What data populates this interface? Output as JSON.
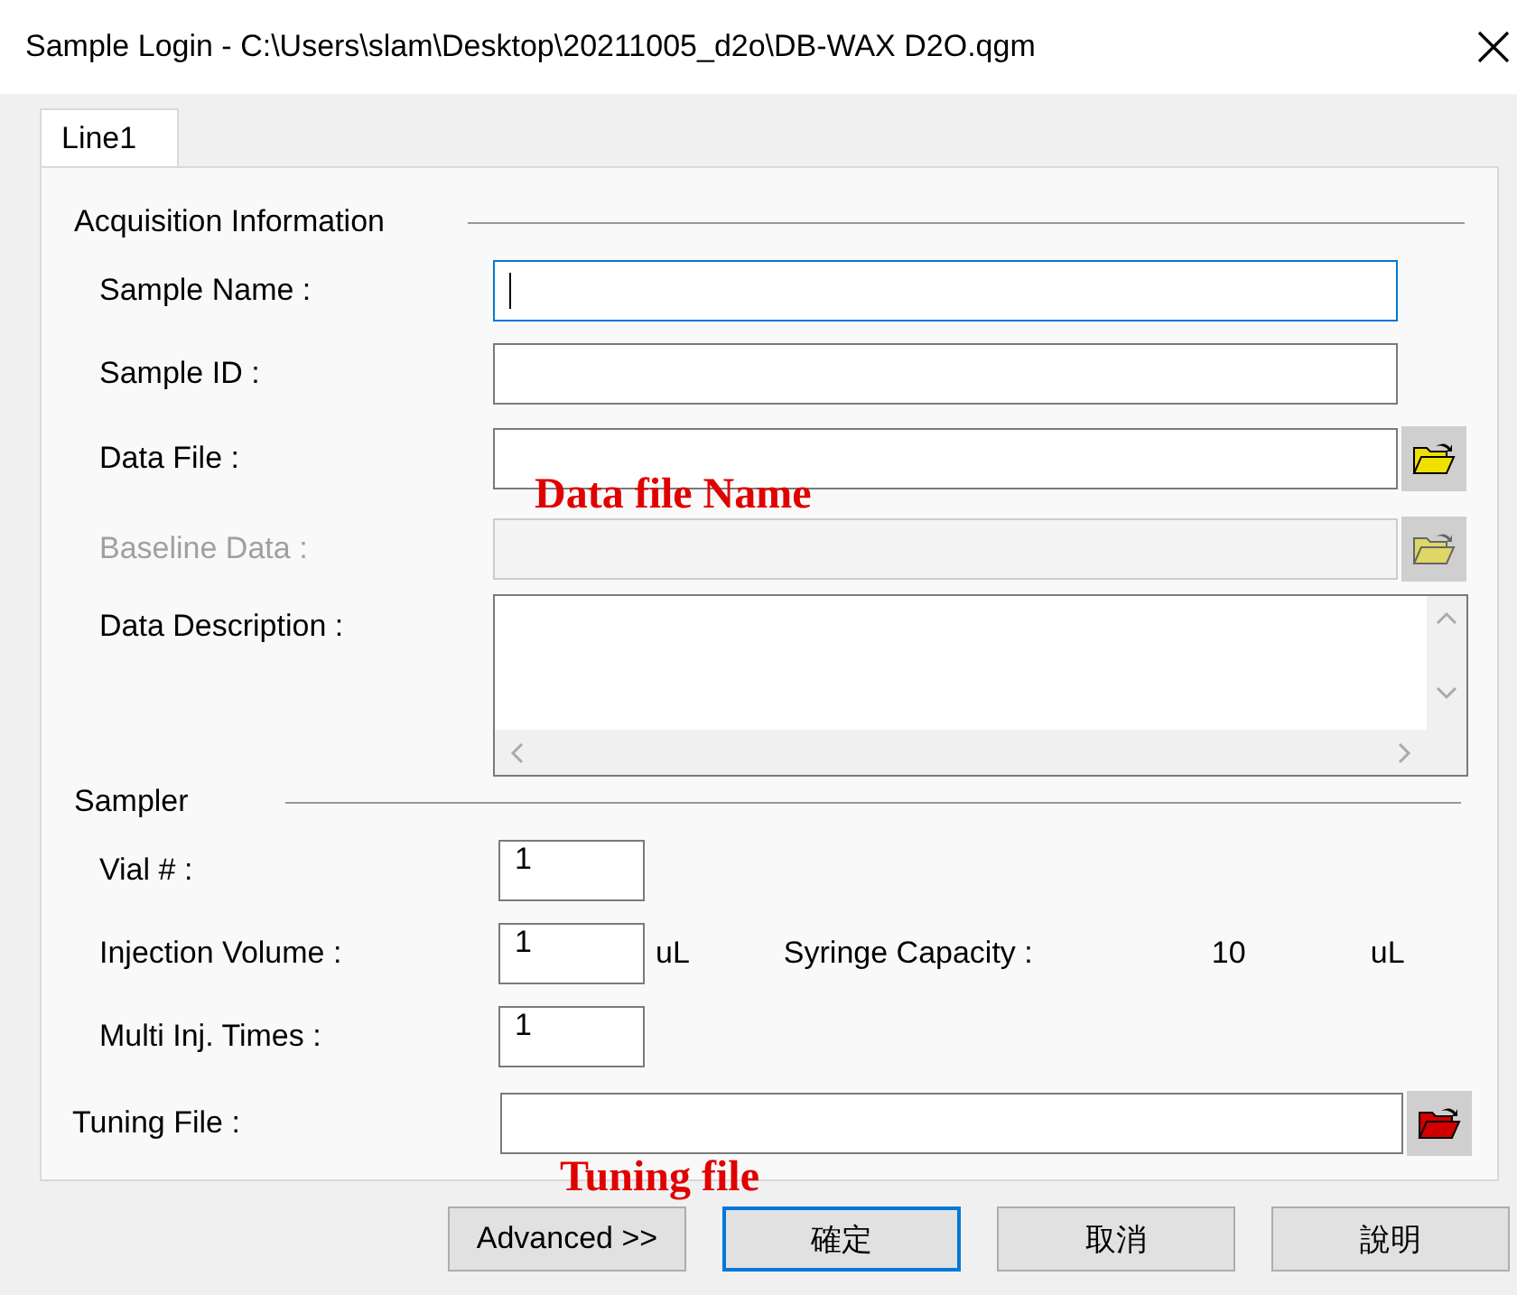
{
  "window": {
    "title": "Sample Login - C:\\Users\\slam\\Desktop\\20211005_d2o\\DB-WAX D2O.qgm"
  },
  "tabs": [
    {
      "label": "Line1",
      "selected": true
    }
  ],
  "acquisition": {
    "heading": "Acquisition Information",
    "fields": [
      {
        "label": "Sample Name :",
        "kind": "text",
        "focused": true,
        "disabled": false
      },
      {
        "label": "Sample ID :",
        "kind": "text",
        "focused": false,
        "disabled": false
      },
      {
        "label": "Data File :",
        "kind": "file",
        "focused": false,
        "disabled": false
      },
      {
        "label": "Baseline Data :",
        "kind": "file",
        "focused": false,
        "disabled": true
      },
      {
        "label": "Data Description :",
        "kind": "multiline",
        "focused": false,
        "disabled": false
      }
    ]
  },
  "sampler": {
    "heading": "Sampler",
    "fields": [
      {
        "label": "Vial # :",
        "value": "1"
      },
      {
        "label": "Injection Volume :",
        "value": "1",
        "unit": "uL"
      },
      {
        "label": "Multi Inj. Times :",
        "value": "1"
      }
    ],
    "syringe": {
      "label": "Syringe Capacity :",
      "value": "10",
      "unit": "uL"
    }
  },
  "tuning_file": {
    "label": "Tuning File :"
  },
  "buttons": [
    {
      "label": "Advanced >>",
      "default": false
    },
    {
      "label": "確定",
      "default": true
    },
    {
      "label": "取消",
      "default": false
    },
    {
      "label": "說明",
      "default": false
    }
  ],
  "annotations": [
    {
      "text": "Data file Name"
    },
    {
      "text": "Tuning file"
    }
  ]
}
